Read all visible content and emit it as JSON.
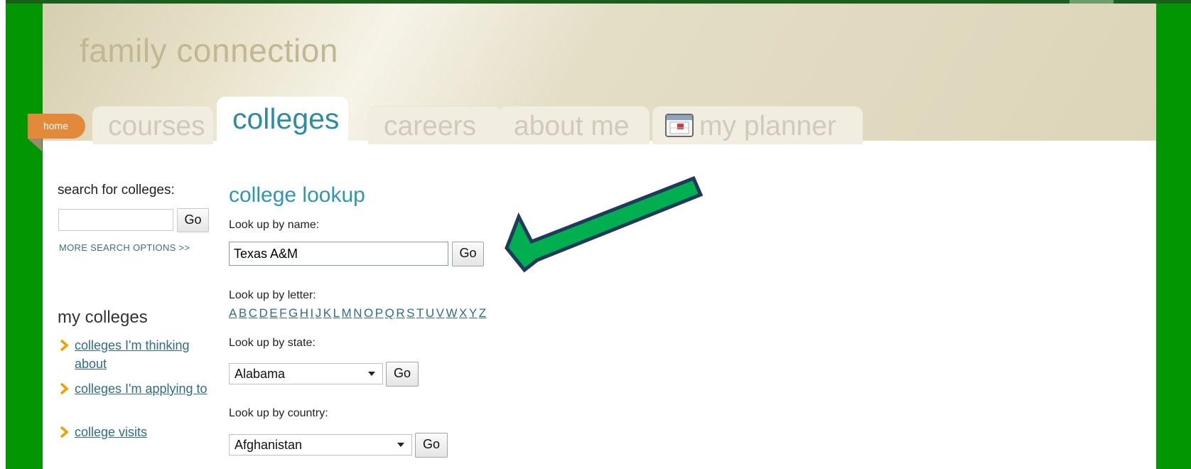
{
  "site": {
    "title": "family connection"
  },
  "nav": {
    "home": "home",
    "tabs": [
      {
        "label": "courses"
      },
      {
        "label": "colleges"
      },
      {
        "label": "careers"
      },
      {
        "label": "about me"
      },
      {
        "label": "my planner"
      }
    ],
    "active_tab": "colleges"
  },
  "sidebar": {
    "search_heading": "search for colleges:",
    "search_input_value": "",
    "go_label": "Go",
    "more_options": "MORE SEARCH OPTIONS >>",
    "my_colleges_heading": "my colleges",
    "my_colleges_items": [
      {
        "label": "colleges I'm thinking about"
      },
      {
        "label": "colleges I'm applying to"
      },
      {
        "label": "college visits"
      }
    ]
  },
  "lookup": {
    "title": "college lookup",
    "by_name_label": "Look up by name:",
    "name_value": "Texas A&M",
    "go_label": "Go",
    "by_letter_label": "Look up by letter:",
    "letters": [
      "A",
      "B",
      "C",
      "D",
      "E",
      "F",
      "G",
      "H",
      "I",
      "J",
      "K",
      "L",
      "M",
      "N",
      "O",
      "P",
      "Q",
      "R",
      "S",
      "T",
      "U",
      "V",
      "W",
      "X",
      "Y",
      "Z"
    ],
    "by_state_label": "Look up by state:",
    "state_selected": "Alabama",
    "by_country_label": "Look up by country:",
    "country_selected": "Afghanistan"
  },
  "colors": {
    "frame_green": "#029702",
    "accent_teal": "#2e97b0",
    "home_orange": "#e3893a",
    "callout_arrow": "#00b050"
  },
  "icons": {
    "planner": "planner-calendar-icon",
    "chevron": "chevron-right-icon",
    "callout": "green-callout-arrow"
  }
}
